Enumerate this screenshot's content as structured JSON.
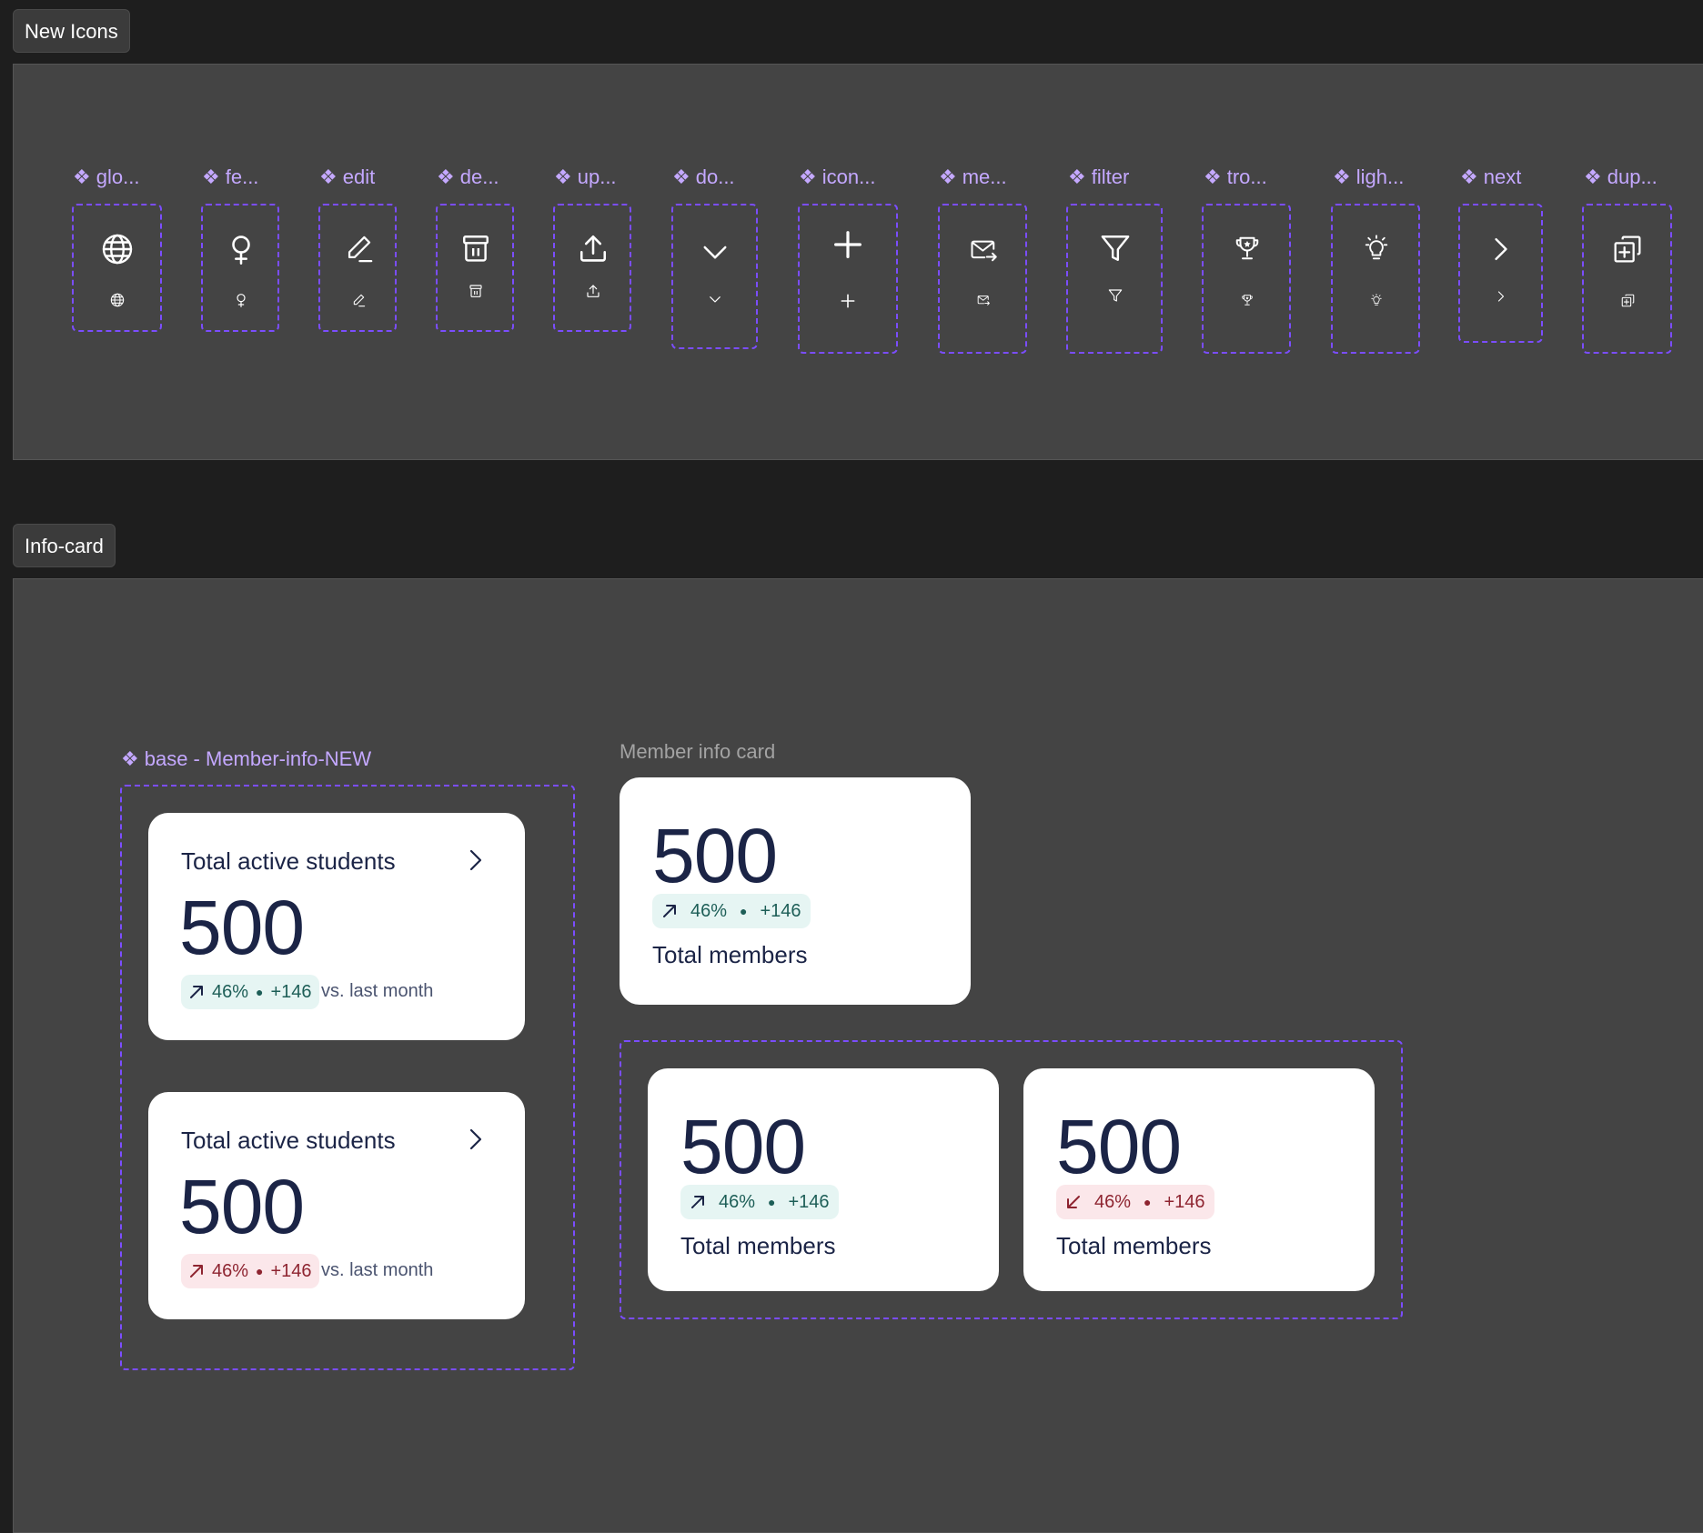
{
  "sections": {
    "icons_tab": "New Icons",
    "infocard_tab": "Info-card"
  },
  "icons": [
    {
      "label": "glo...",
      "icon": "globe-icon"
    },
    {
      "label": "fe...",
      "icon": "female-icon"
    },
    {
      "label": "edit",
      "icon": "edit-icon"
    },
    {
      "label": "de...",
      "icon": "delete-icon"
    },
    {
      "label": "up...",
      "icon": "upload-icon"
    },
    {
      "label": "do...",
      "icon": "chevron-down-icon"
    },
    {
      "label": "icon...",
      "icon": "plus-icon"
    },
    {
      "label": "me...",
      "icon": "message-send-icon"
    },
    {
      "label": "filter",
      "icon": "filter-icon"
    },
    {
      "label": "tro...",
      "icon": "trophy-icon"
    },
    {
      "label": "ligh...",
      "icon": "lightbulb-icon"
    },
    {
      "label": "next",
      "icon": "chevron-right-icon"
    },
    {
      "label": "dup...",
      "icon": "duplicate-icon"
    }
  ],
  "component_marker": "❖",
  "base_component": {
    "label": "base - Member-info-NEW",
    "cards": [
      {
        "title": "Total active students",
        "value": "500",
        "trend": "up",
        "percent": "46%",
        "delta": "+146",
        "compare": "vs. last month"
      },
      {
        "title": "Total active students",
        "value": "500",
        "trend": "up-negative",
        "percent": "46%",
        "delta": "+146",
        "compare": "vs. last month"
      }
    ]
  },
  "member_info": {
    "caption": "Member info card",
    "card": {
      "value": "500",
      "trend": "up",
      "percent": "46%",
      "delta": "+146",
      "label": "Total members"
    },
    "variants": [
      {
        "value": "500",
        "trend": "up",
        "percent": "46%",
        "delta": "+146",
        "label": "Total members"
      },
      {
        "value": "500",
        "trend": "down",
        "percent": "46%",
        "delta": "+146",
        "label": "Total members"
      }
    ]
  },
  "colors": {
    "canvas": "#1e1e1e",
    "frame": "#444444",
    "component_purple": "#7b4dff",
    "label_purple": "#c4a8ff",
    "text_navy": "#1b2446",
    "pill_up_bg": "#e6f5f3",
    "pill_up_fg": "#1d5e57",
    "pill_down_bg": "#fbe7ea",
    "pill_down_fg": "#8e2430"
  }
}
